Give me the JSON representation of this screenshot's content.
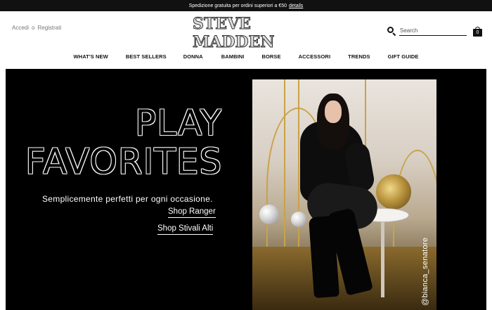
{
  "promo": {
    "text": "Spedizione gratuita per ordini superiori a €50",
    "link": "details"
  },
  "account": {
    "login": "Accedi",
    "or": "o",
    "register": "Registrati"
  },
  "logo": {
    "text": "STEVE MADDEN"
  },
  "search": {
    "placeholder": "Search",
    "icon": "search-icon"
  },
  "cart": {
    "count": "0",
    "icon": "shopping-bag-icon"
  },
  "nav": {
    "items": [
      {
        "label": "WHAT'S NEW"
      },
      {
        "label": "BEST SELLERS"
      },
      {
        "label": "DONNA"
      },
      {
        "label": "BAMBINI"
      },
      {
        "label": "BORSE"
      },
      {
        "label": "ACCESSORI"
      },
      {
        "label": "TRENDS"
      },
      {
        "label": "GIFT GUIDE"
      }
    ]
  },
  "hero": {
    "headline_line1": "PLAY",
    "headline_line2": "FAVORITES",
    "tagline": "Semplicemente perfetti per ogni occasione.",
    "cta1": "Shop Ranger",
    "cta2": "Shop Stivali Alti",
    "photo_credit": "@bianca_senatore"
  },
  "colors": {
    "background": "#000000",
    "text": "#ffffff",
    "promo_bar": "#111111",
    "accent_gold": "#c9a24a"
  }
}
